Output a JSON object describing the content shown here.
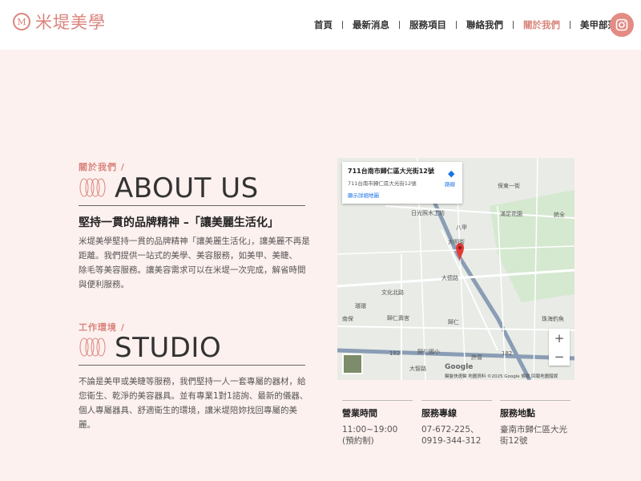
{
  "brand": {
    "name": "米堤美學",
    "mark": "M"
  },
  "nav": {
    "items": [
      "首頁",
      "最新消息",
      "服務項目",
      "聯絡我們",
      "關於我們",
      "美甲部落"
    ],
    "active_index": 4
  },
  "about": {
    "label": "關於我們 /",
    "title": "ABOUT US",
    "slogan": "堅持一貫的品牌精神 –「讓美麗生活化」",
    "text_lines": [
      "米堤美學堅持一貫的品牌精神「讓美麗生活化」，讓美麗不再是",
      "距離。我們提供一站式的美學、美容服務，如美甲、美睫、",
      "除毛等美容服務。讓美容需求可以在米堤一次完成，解省時間",
      "與便利服務。"
    ]
  },
  "studio": {
    "label": "工作環境 /",
    "title": "STUDIO",
    "text_lines": [
      "不論是美甲或美睫等服務，我們堅持一人一套專屬的器材，給",
      "您衛生、乾淨的美容器具。並有專業1對1諮詢、最新的儀器、",
      "個人專屬器具、舒適衛生的環境，讓米堤陪妳找回專屬的美",
      "麗。"
    ]
  },
  "map": {
    "address": "711台南市歸仁區大光街12號",
    "address_sub": "711台南市歸仁區大光街12號",
    "more_link": "顯示詳細地圖",
    "directions": "路線",
    "zoom_in": "+",
    "zoom_out": "−",
    "google": "Google",
    "footer": "鍵盤快速鍵   地圖資料 ©2025 Google   條款   回報地圖錯誤",
    "labels": [
      "日光照木工坊",
      "滿足花園",
      "八甲",
      "大明街",
      "大德路",
      "文化北路",
      "環環",
      "南保",
      "歸仁壽宮",
      "歸仁",
      "歸仁國小",
      "珠海釣魚",
      "統全",
      "保東一街",
      "182",
      "182",
      "許厝",
      "大智路"
    ]
  },
  "info": [
    {
      "title": "營業時間",
      "lines": [
        "11:00~19:00",
        "(預約制)"
      ]
    },
    {
      "title": "服務專線",
      "lines": [
        "07-672-225、",
        "0919-344-312"
      ]
    },
    {
      "title": "服務地點",
      "lines": [
        "臺南市歸仁區大光",
        "街12號"
      ]
    }
  ],
  "colors": {
    "accent": "#d9857d",
    "background": "#fdf1ef",
    "ig_button": "#e48b84"
  }
}
